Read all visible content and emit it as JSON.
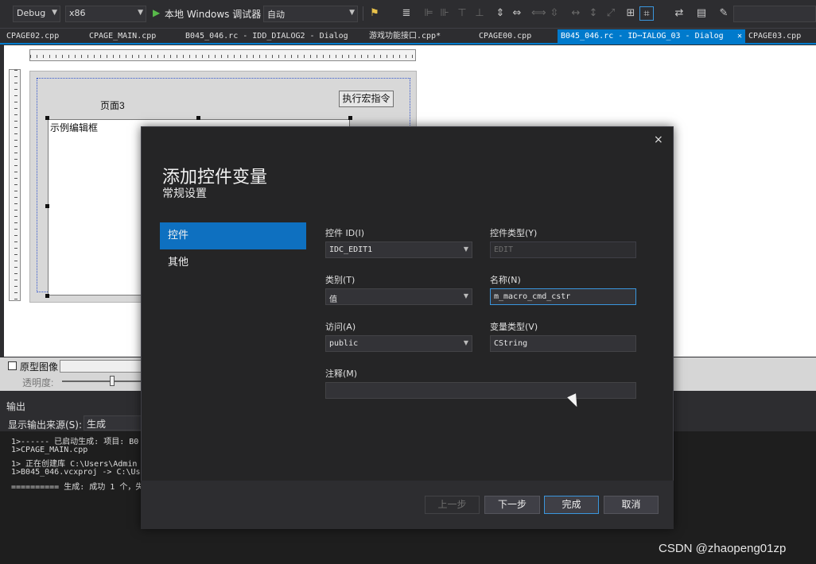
{
  "toolbar": {
    "config": "Debug",
    "platform": "x86",
    "run_label": "本地 Windows 调试器",
    "auto": "自动"
  },
  "tabs": [
    {
      "label": "CPAGE02.cpp"
    },
    {
      "label": "CPAGE_MAIN.cpp"
    },
    {
      "label": "B045_046.rc - IDD_DIALOG2 - Dialog"
    },
    {
      "label": "游戏功能接口.cpp*"
    },
    {
      "label": "CPAGE00.cpp"
    },
    {
      "label": "B045_046.rc - ID⋯IALOG_03 - Dialog"
    },
    {
      "label": "CPAGE03.cpp"
    }
  ],
  "designer": {
    "page_label": "页面3",
    "exec_button": "执行宏指令",
    "edit_text": "示例编辑框",
    "proto_label": "原型图像",
    "alpha_label": "透明度:"
  },
  "output": {
    "title": "输出",
    "source_label": "显示输出来源(S):",
    "source_value": "生成",
    "lines": [
      "1>------ 已启动生成: 项目: B0",
      "1>CPAGE_MAIN.cpp",
      "1>  正在创建库 C:\\Users\\Admin",
      "1>B045_046.vcxproj -> C:\\User",
      "========== 生成: 成功 1 个，失"
    ]
  },
  "modal": {
    "title": "添加控件变量",
    "subtitle": "常规设置",
    "close": "×",
    "nav": [
      {
        "label": "控件",
        "active": true
      },
      {
        "label": "其他",
        "active": false
      }
    ],
    "fields": {
      "control_id_label": "控件 ID(I)",
      "control_id_value": "IDC_EDIT1",
      "control_type_label": "控件类型(Y)",
      "control_type_value": "EDIT",
      "category_label": "类别(T)",
      "category_value": "值",
      "name_label": "名称(N)",
      "name_value": "m_macro_cmd_cstr",
      "access_label": "访问(A)",
      "access_value": "public",
      "var_type_label": "变量类型(V)",
      "var_type_value": "CString",
      "comment_label": "注释(M)",
      "comment_value": ""
    },
    "buttons": {
      "prev": "上一步",
      "next": "下一步",
      "finish": "完成",
      "cancel": "取消"
    }
  },
  "watermark": "CSDN @zhaopeng01zp"
}
